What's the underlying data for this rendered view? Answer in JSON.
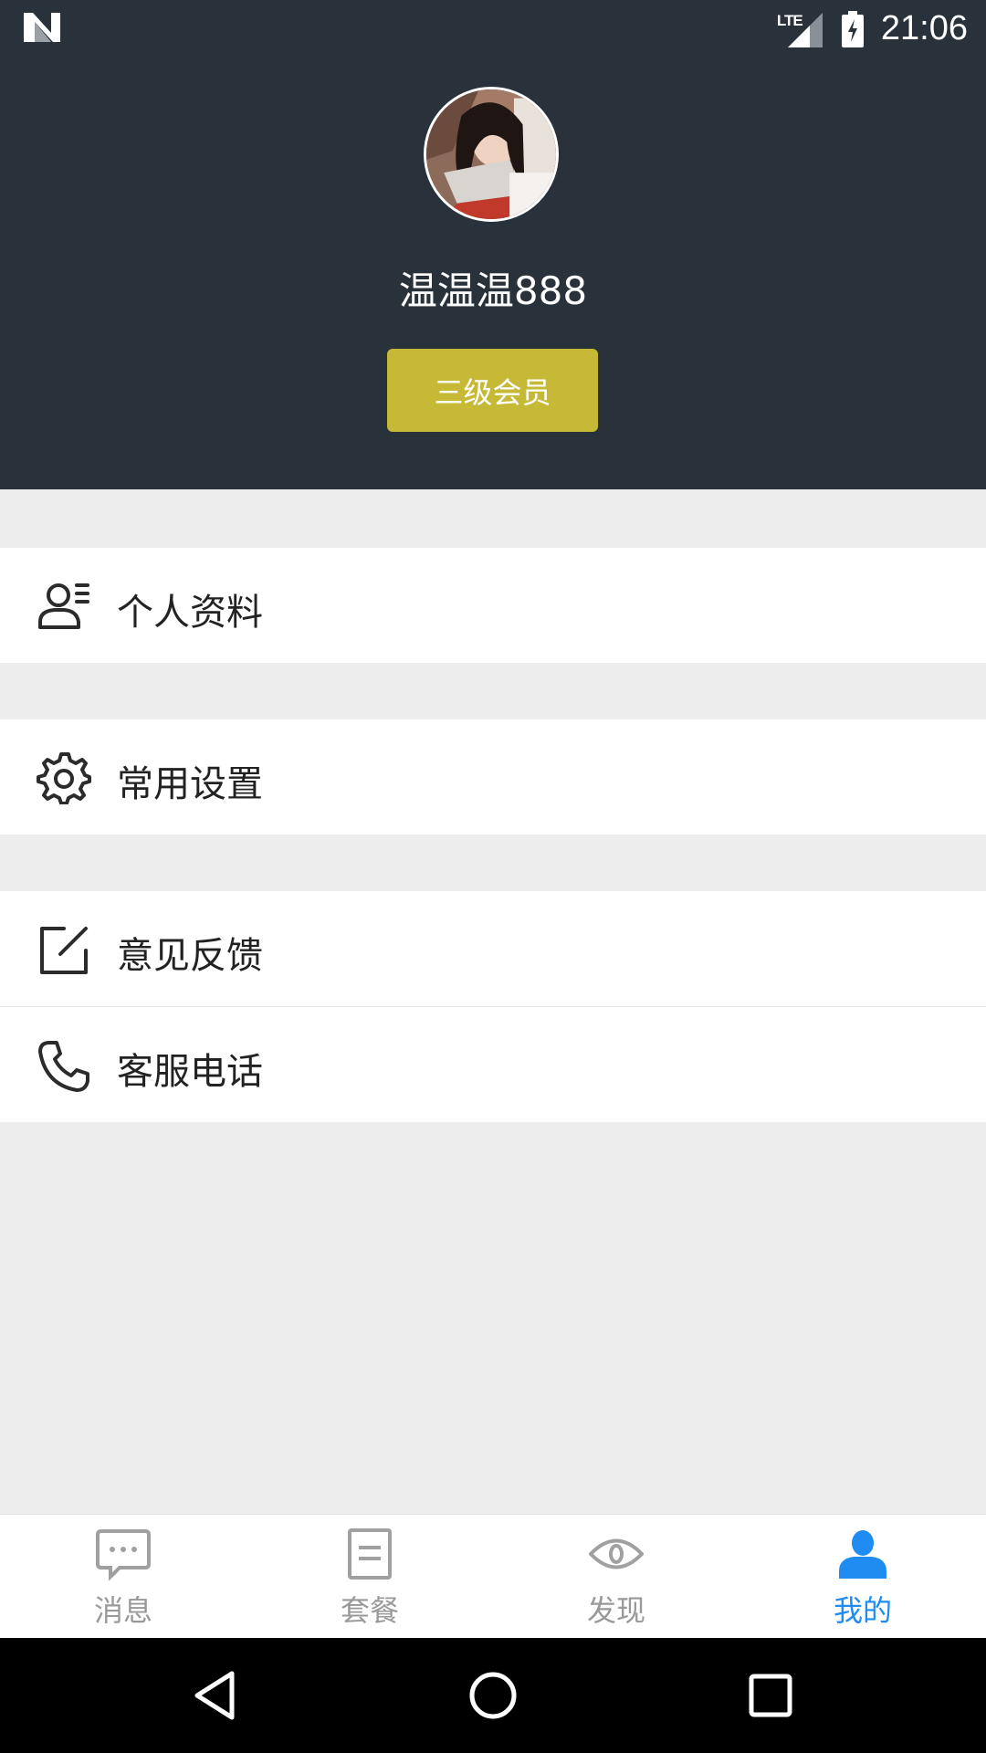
{
  "status_bar": {
    "network": "LTE",
    "time": "21:06"
  },
  "profile": {
    "username": "温温温888",
    "member_level": "三级会员"
  },
  "menu": [
    {
      "label": "个人资料",
      "icon": "person-list-icon"
    },
    {
      "label": "常用设置",
      "icon": "gear-icon"
    },
    {
      "label": "意见反馈",
      "icon": "edit-icon"
    },
    {
      "label": "客服电话",
      "icon": "phone-icon"
    }
  ],
  "tabs": [
    {
      "label": "消息",
      "icon": "chat-bubble-icon",
      "active": false
    },
    {
      "label": "套餐",
      "icon": "document-icon",
      "active": false
    },
    {
      "label": "发现",
      "icon": "eye-icon",
      "active": false
    },
    {
      "label": "我的",
      "icon": "person-icon",
      "active": true
    }
  ],
  "colors": {
    "header_bg": "#29313a",
    "badge_bg": "#c6b935",
    "active_tab": "#1e8cf0",
    "inactive_tab": "#999999"
  }
}
